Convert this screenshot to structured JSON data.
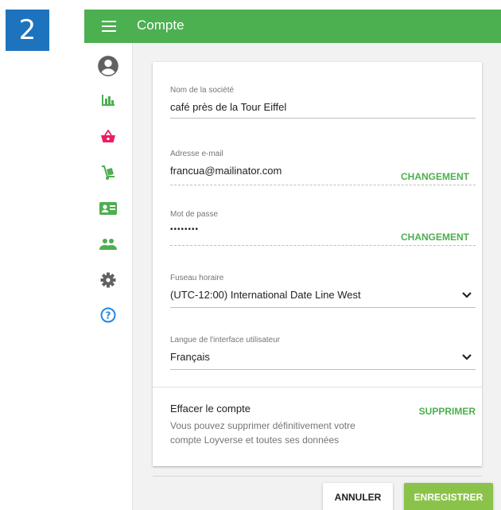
{
  "step_number": "2",
  "header": {
    "title": "Compte"
  },
  "sidebar": {
    "items": [
      {
        "icon": "account-circle-icon"
      },
      {
        "icon": "bar-chart-icon"
      },
      {
        "icon": "basket-icon"
      },
      {
        "icon": "hand-truck-icon"
      },
      {
        "icon": "id-card-icon"
      },
      {
        "icon": "people-icon"
      },
      {
        "icon": "gear-icon"
      },
      {
        "icon": "help-icon"
      }
    ]
  },
  "form": {
    "company": {
      "label": "Nom de la société",
      "value": "café près de la Tour Eiffel"
    },
    "email": {
      "label": "Adresse e-mail",
      "value": "francua@mailinator.com",
      "action": "CHANGEMENT"
    },
    "password": {
      "label": "Mot de passe",
      "value": "••••••••",
      "action": "CHANGEMENT"
    },
    "timezone": {
      "label": "Fuseau horaire",
      "value": "(UTC-12:00) International Date Line West"
    },
    "language": {
      "label": "Langue de l'interface utilisateur",
      "value": "Français"
    }
  },
  "delete_account": {
    "title": "Effacer le compte",
    "description": "Vous pouvez supprimer définitivement votre compte Loyverse et toutes ses données",
    "action": "SUPPRIMER"
  },
  "footer": {
    "cancel_label": "ANNULER",
    "save_label": "ENREGISTRER"
  },
  "colors": {
    "primary": "#4caf50",
    "save_button": "#8bc34a",
    "step_badge": "#1e73be",
    "basket_icon": "#e91e63",
    "nav_icon": "#4caf50",
    "help_icon": "#1e88e5"
  }
}
